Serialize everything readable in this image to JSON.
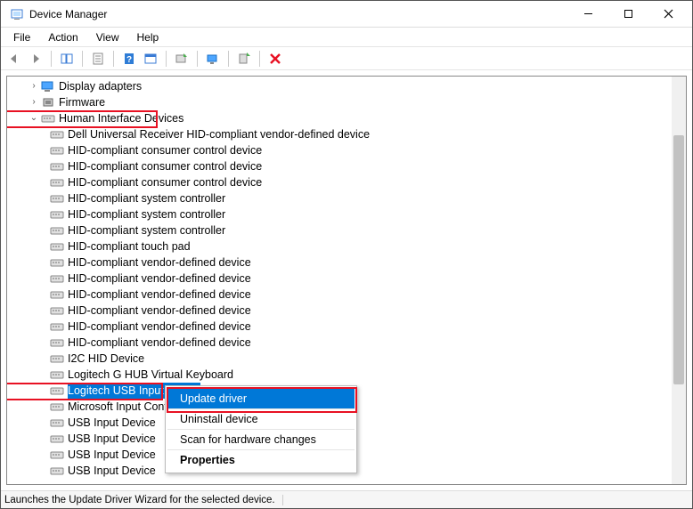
{
  "window": {
    "title": "Device Manager"
  },
  "menus": {
    "file": "File",
    "action": "Action",
    "view": "View",
    "help": "Help"
  },
  "categories": {
    "display_adapters": {
      "label": "Display adapters"
    },
    "firmware": {
      "label": "Firmware"
    },
    "hid": {
      "label": "Human Interface Devices"
    }
  },
  "hid_devices": [
    "Dell Universal Receiver HID-compliant vendor-defined device",
    "HID-compliant consumer control device",
    "HID-compliant consumer control device",
    "HID-compliant consumer control device",
    "HID-compliant system controller",
    "HID-compliant system controller",
    "HID-compliant system controller",
    "HID-compliant touch pad",
    "HID-compliant vendor-defined device",
    "HID-compliant vendor-defined device",
    "HID-compliant vendor-defined device",
    "HID-compliant vendor-defined device",
    "HID-compliant vendor-defined device",
    "HID-compliant vendor-defined device",
    "I2C HID Device",
    "Logitech G HUB Virtual Keyboard",
    "Logitech USB Input Device",
    "Microsoft Input Configur",
    "USB Input Device",
    "USB Input Device",
    "USB Input Device",
    "USB Input Device"
  ],
  "selected_index": 16,
  "context_menu": {
    "update": "Update driver",
    "uninstall": "Uninstall device",
    "scan": "Scan for hardware changes",
    "properties": "Properties"
  },
  "status_text": "Launches the Update Driver Wizard for the selected device."
}
